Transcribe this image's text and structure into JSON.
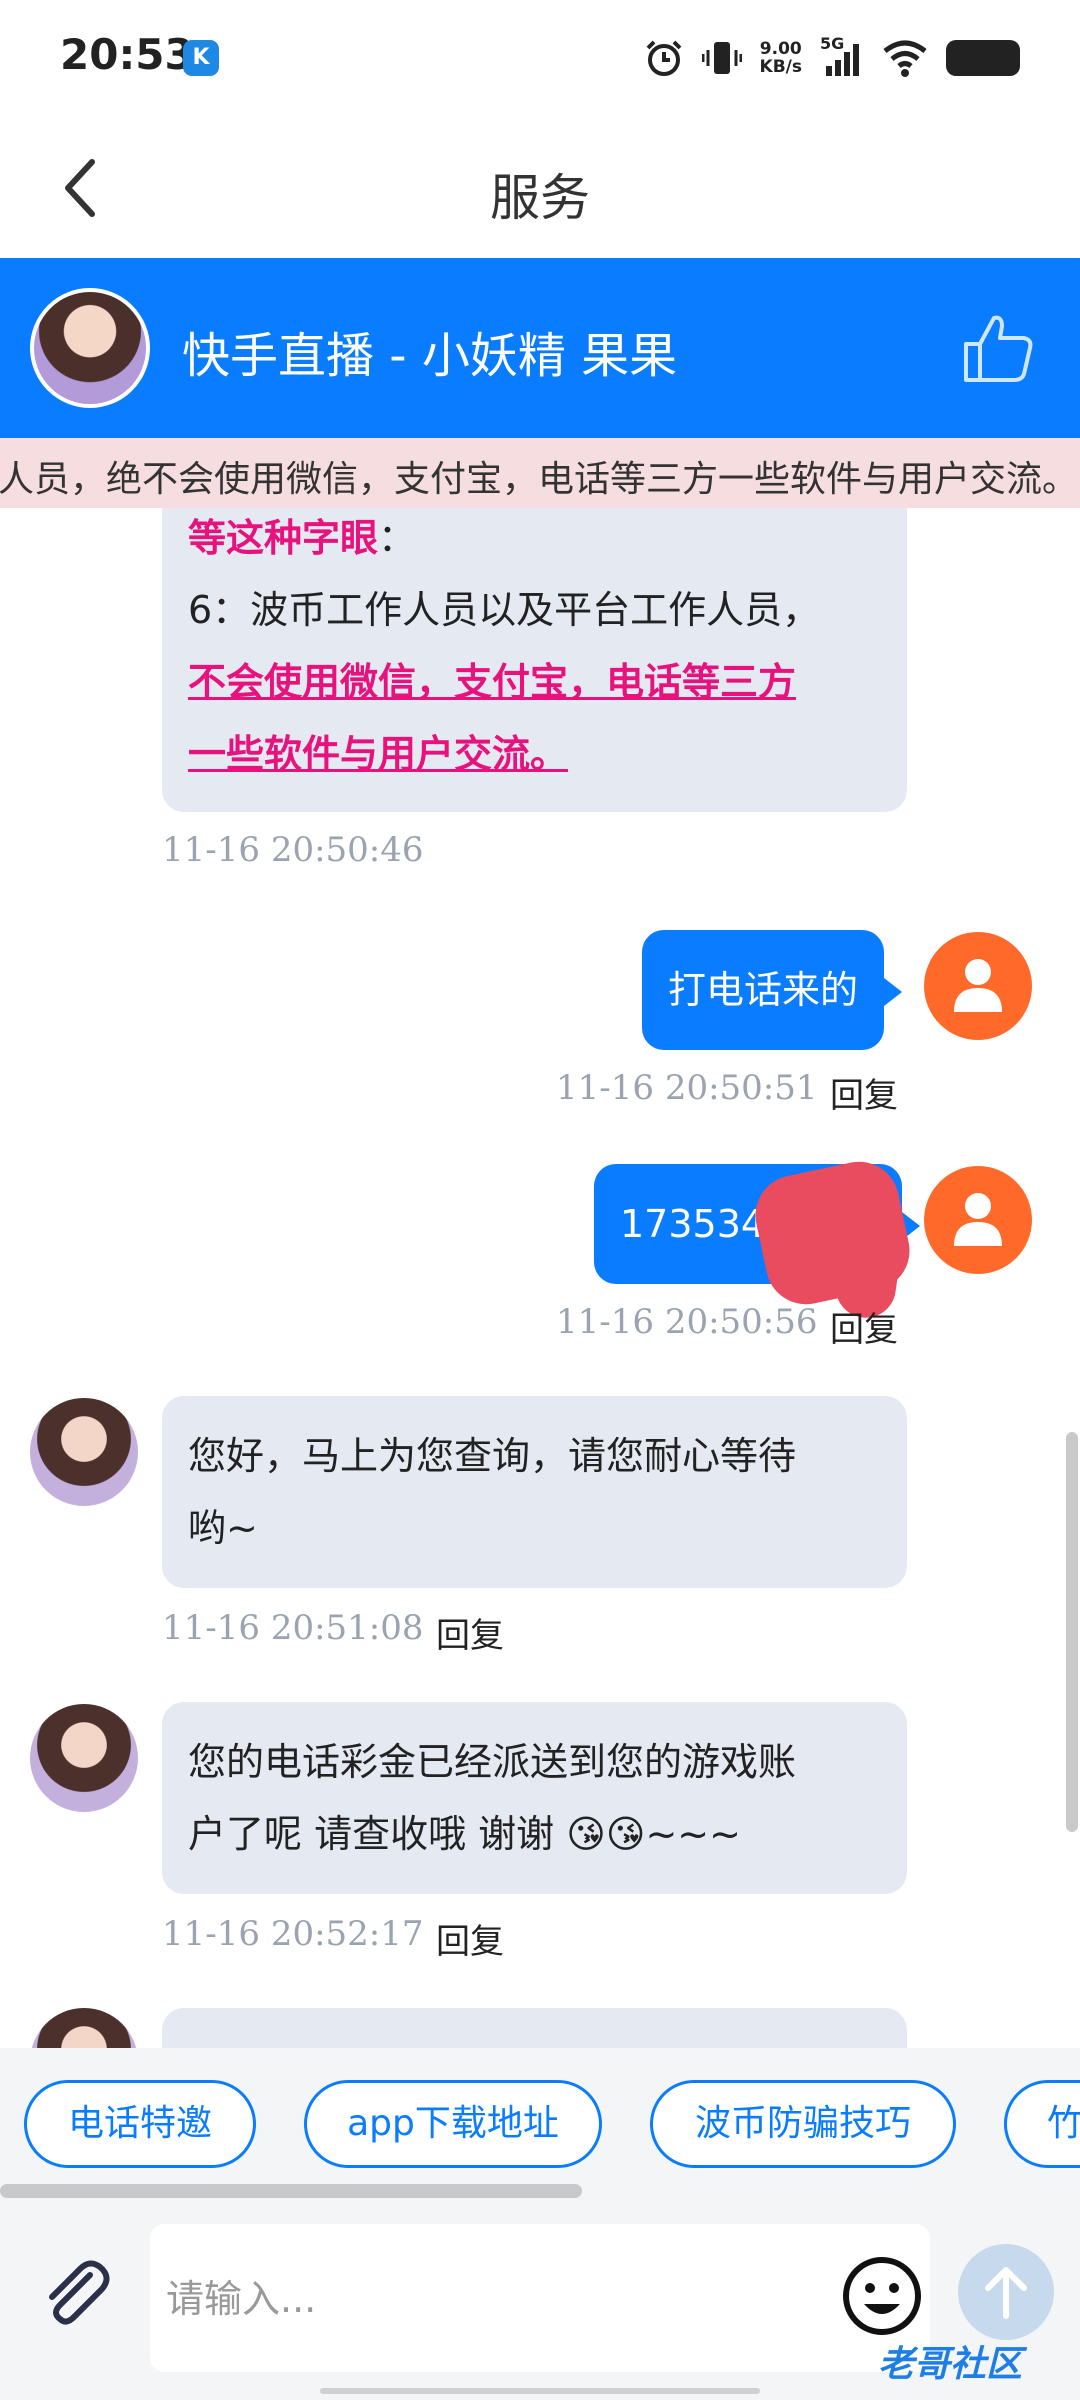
{
  "status_bar": {
    "time": "20:53",
    "badge": "K",
    "speed_value": "9.00",
    "speed_unit": "KB/s",
    "network": "5G"
  },
  "title_bar": {
    "title": "服务"
  },
  "agent": {
    "name": "快手直播 - 小妖精 果果"
  },
  "notice": {
    "text": "人员，绝不会使用微信，支付宝，电话等三方一些软件与用户交流。"
  },
  "messages": [
    {
      "side": "in",
      "line1_pink": "等这种字眼",
      "line1_rest": "：",
      "line2": "6：波币工作人员以及平台工作人员，",
      "line3": "不会使用微信，支付宝，电话等三方",
      "line4": "一些软件与用户交流。",
      "time": "11-16 20:50:46"
    },
    {
      "side": "out",
      "text": "打电话来的",
      "time": "11-16 20:50:51",
      "reply": "回复"
    },
    {
      "side": "out",
      "text": "173534",
      "time": "11-16 20:50:56",
      "reply": "回复"
    },
    {
      "side": "in",
      "line1": "您好，马上为您查询，请您耐心等待",
      "line2": "哟~",
      "time": "11-16 20:51:08",
      "reply": "回复"
    },
    {
      "side": "in",
      "line1": "您的电话彩金已经派送到您的游戏账",
      "line2": "户了呢  请查收哦  谢谢 😘😘~~~",
      "time": "11-16 20:52:17",
      "reply": "回复"
    }
  ],
  "quick_replies": [
    "电话特邀",
    "app下载地址",
    "波币防骗技巧",
    "竹"
  ],
  "input": {
    "placeholder": "请输入..."
  },
  "watermark": "老哥社区",
  "colors": {
    "primary": "#0a7cff",
    "pink": "#e8127c",
    "user_avatar": "#ff6a2b",
    "incoming_bubble": "#e4e9f2"
  },
  "icons": [
    "back-arrow-icon",
    "thumbs-up-icon",
    "user-icon",
    "paperclip-icon",
    "smiley-icon",
    "send-arrow-icon"
  ]
}
